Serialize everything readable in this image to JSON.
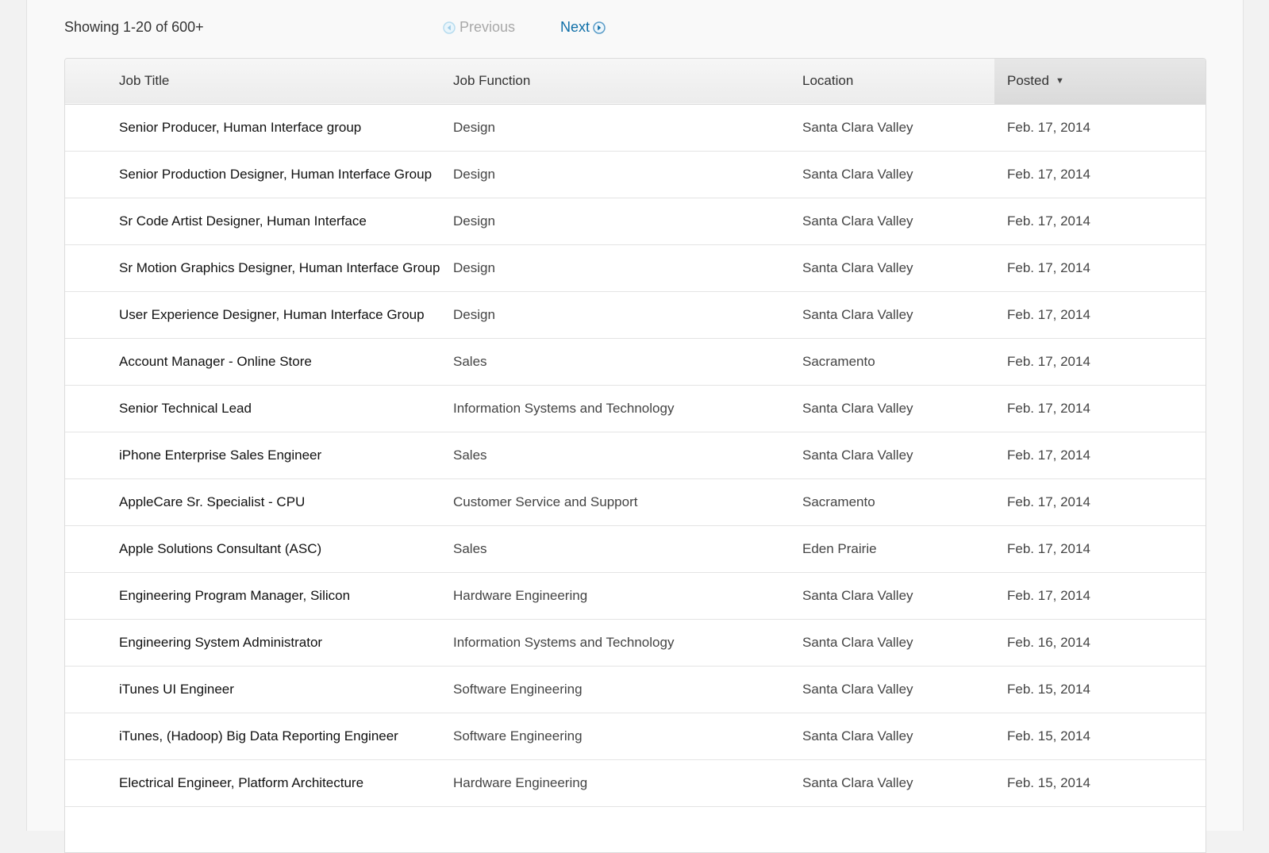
{
  "pagination": {
    "showing": "Showing 1-20 of 600+",
    "previous": "Previous",
    "next": "Next"
  },
  "table": {
    "headers": {
      "title": "Job Title",
      "function": "Job Function",
      "location": "Location",
      "posted": "Posted"
    },
    "sort_indicator": "▼",
    "rows": [
      {
        "title": "Senior Producer, Human Interface group",
        "function": "Design",
        "location": "Santa Clara Valley",
        "posted": "Feb. 17, 2014"
      },
      {
        "title": "Senior Production Designer, Human Interface Group",
        "function": "Design",
        "location": "Santa Clara Valley",
        "posted": "Feb. 17, 2014"
      },
      {
        "title": "Sr Code Artist Designer, Human Interface",
        "function": "Design",
        "location": "Santa Clara Valley",
        "posted": "Feb. 17, 2014"
      },
      {
        "title": "Sr Motion Graphics Designer, Human Interface Group",
        "function": "Design",
        "location": "Santa Clara Valley",
        "posted": "Feb. 17, 2014"
      },
      {
        "title": "User Experience Designer, Human Interface Group",
        "function": "Design",
        "location": "Santa Clara Valley",
        "posted": "Feb. 17, 2014"
      },
      {
        "title": "Account Manager - Online Store",
        "function": "Sales",
        "location": "Sacramento",
        "posted": "Feb. 17, 2014"
      },
      {
        "title": "Senior Technical Lead",
        "function": "Information Systems and Technology",
        "location": "Santa Clara Valley",
        "posted": "Feb. 17, 2014"
      },
      {
        "title": "iPhone Enterprise Sales Engineer",
        "function": "Sales",
        "location": "Santa Clara Valley",
        "posted": "Feb. 17, 2014"
      },
      {
        "title": "AppleCare Sr. Specialist - CPU",
        "function": "Customer Service and Support",
        "location": "Sacramento",
        "posted": "Feb. 17, 2014"
      },
      {
        "title": "Apple Solutions Consultant (ASC)",
        "function": "Sales",
        "location": "Eden Prairie",
        "posted": "Feb. 17, 2014"
      },
      {
        "title": "Engineering Program Manager, Silicon",
        "function": "Hardware Engineering",
        "location": "Santa Clara Valley",
        "posted": "Feb. 17, 2014"
      },
      {
        "title": "Engineering System Administrator",
        "function": "Information Systems and Technology",
        "location": "Santa Clara Valley",
        "posted": "Feb. 16, 2014"
      },
      {
        "title": "iTunes UI Engineer",
        "function": "Software Engineering",
        "location": "Santa Clara Valley",
        "posted": "Feb. 15, 2014"
      },
      {
        "title": "iTunes, (Hadoop) Big Data Reporting Engineer",
        "function": "Software Engineering",
        "location": "Santa Clara Valley",
        "posted": "Feb. 15, 2014"
      },
      {
        "title": "Electrical Engineer, Platform Architecture",
        "function": "Hardware Engineering",
        "location": "Santa Clara Valley",
        "posted": "Feb. 15, 2014"
      }
    ]
  },
  "colors": {
    "link": "#0f6fa8",
    "disabled": "#a8a8a8",
    "prev_icon": "#b7dcef",
    "next_icon": "#0f6fa8"
  },
  "icons": {
    "previous": "circle-left-arrow-icon",
    "next": "circle-right-arrow-icon",
    "sort": "sort-down-icon"
  }
}
